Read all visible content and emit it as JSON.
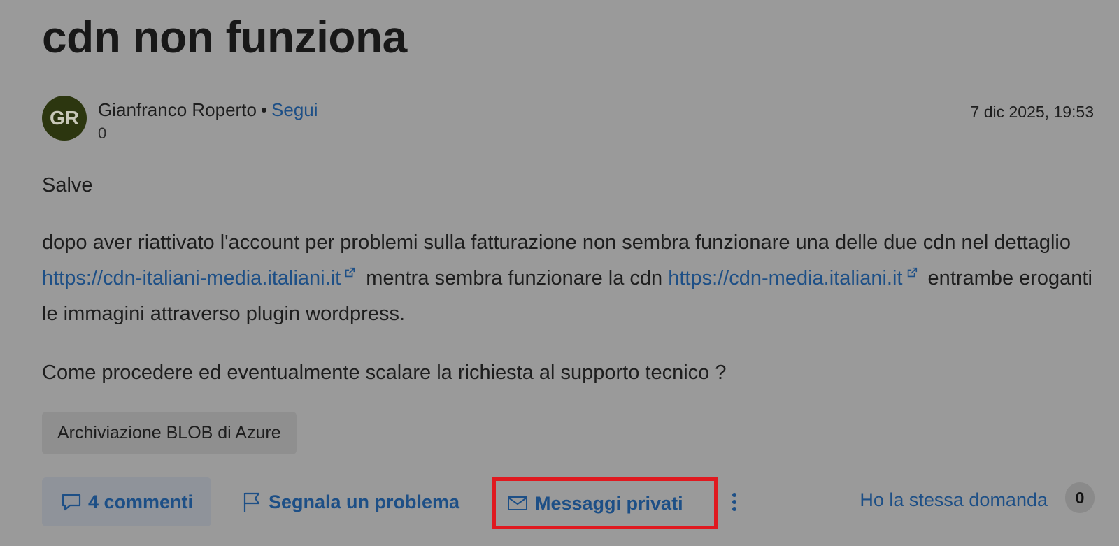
{
  "post": {
    "title": "cdn non funziona",
    "author": {
      "initials": "GR",
      "avatar_color": "#2c360f",
      "name": "Gianfranco Roperto",
      "separator": "•",
      "follow_label": "Segui",
      "reputation": "0"
    },
    "timestamp": "7 dic 2025, 19:53",
    "body": {
      "greeting": "Salve",
      "p2_part1": "dopo aver riattivato l'account per problemi sulla fatturazione non sembra funzionare una delle due cdn nel dettaglio ",
      "link1": "https://cdn-italiani-media.italiani.it",
      "p2_part2": " mentra sembra funzionare la cdn ",
      "link2": "https://cdn-media.italiani.it",
      "p2_part3": " entrambe eroganti le immagini attraverso plugin wordpress.",
      "question": "Come procedere ed eventualmente scalare la richiesta al supporto tecnico ?"
    },
    "tags": [
      "Archiviazione BLOB di Azure"
    ]
  },
  "actions": {
    "comments_label": "4 commenti",
    "report_label": "Segnala un problema",
    "private_messages_label": "Messaggi privati",
    "same_question_label": "Ho la stessa domanda",
    "same_question_count": "0"
  },
  "colors": {
    "link": "#1d4f86",
    "highlight_border": "#e0191f",
    "overlay_background": "#9a9a9a"
  },
  "icons": {
    "comments": "comment-icon",
    "report": "flag-icon",
    "private_messages": "mail-icon",
    "more": "more-vertical-icon",
    "external_link": "external-link-icon"
  }
}
